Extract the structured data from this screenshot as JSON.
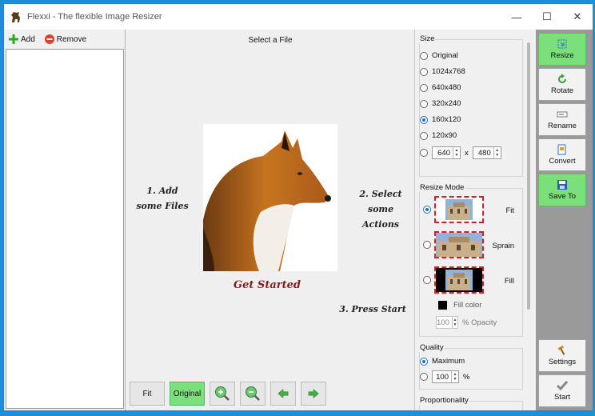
{
  "window": {
    "title": "Flexxi - The flexible Image Resizer",
    "controls": {
      "minimize": "—",
      "maximize": "☐",
      "close": "✕"
    }
  },
  "file_panel": {
    "add_label": "Add",
    "remove_label": "Remove"
  },
  "preview": {
    "header": "Select a File",
    "step1_line1": "1. Add",
    "step1_line2": "some Files",
    "step2_line1": "2. Select",
    "step2_line2": "some Actions",
    "get_started": "Get Started",
    "step3": "3. Press Start"
  },
  "bottom_toolbar": {
    "fit_label": "Fit",
    "original_label": "Original"
  },
  "size": {
    "title": "Size",
    "options": [
      "Original",
      "1024x768",
      "640x480",
      "320x240",
      "160x120",
      "120x90"
    ],
    "selected_index": 4,
    "custom_width": "640",
    "custom_height": "480",
    "times": "x"
  },
  "resize_mode": {
    "title": "Resize Mode",
    "modes": [
      "Fit",
      "Sprain",
      "Fill"
    ],
    "selected": "Fit",
    "fill_color_label": "Fill color",
    "fill_color": "#000000",
    "opacity_value": "100",
    "opacity_label": "% Opacity"
  },
  "quality": {
    "title": "Quality",
    "maximum_label": "Maximum",
    "selected": "Maximum",
    "custom_value": "100",
    "percent": "%"
  },
  "proportionality": {
    "title": "Proportionality"
  },
  "actions": {
    "resize": "Resize",
    "rotate": "Rotate",
    "rename": "Rename",
    "convert": "Convert",
    "save_to": "Save To",
    "settings": "Settings",
    "start": "Start"
  },
  "colors": {
    "accent_green": "#7be07b",
    "title_red": "#8b1818",
    "selection_blue": "#1e6ed0",
    "thumb_border": "#d0202a"
  }
}
